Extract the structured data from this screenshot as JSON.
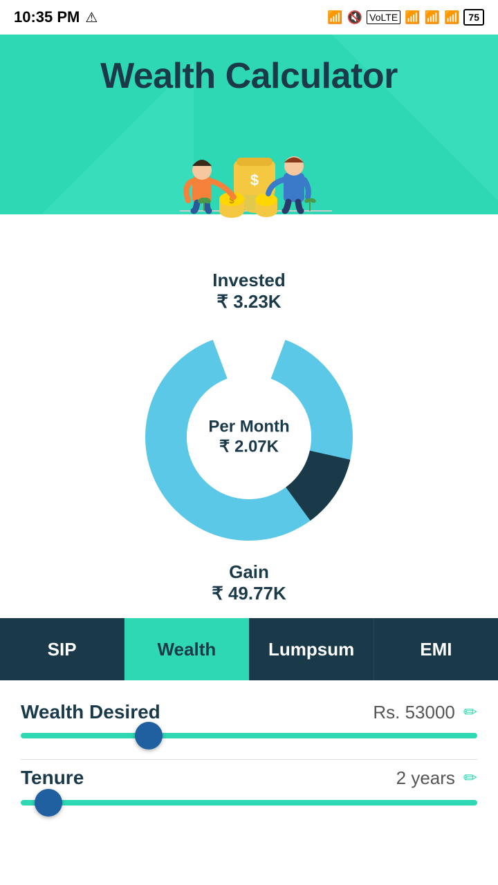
{
  "statusBar": {
    "time": "10:35 PM",
    "alert": "⚠",
    "battery": "75"
  },
  "header": {
    "title": "Wealth Calculator"
  },
  "chart": {
    "invested_label": "Invested",
    "invested_value": "₹ 3.23K",
    "center_label": "Per Month",
    "center_value": "₹ 2.07K",
    "gain_label": "Gain",
    "gain_value": "₹ 49.77K",
    "light_color": "#5cc8e8",
    "dark_color": "#1a3a4a",
    "light_percent": 88,
    "dark_percent": 12
  },
  "tabs": [
    {
      "label": "SIP",
      "active": false
    },
    {
      "label": "Wealth",
      "active": true
    },
    {
      "label": "Lumpsum",
      "active": false
    },
    {
      "label": "EMI",
      "active": false
    }
  ],
  "controls": {
    "wealth_desired_label": "Wealth Desired",
    "wealth_desired_value": "Rs. 53000",
    "edit_icon": "✏",
    "tenure_label": "Tenure",
    "tenure_value": "2",
    "tenure_unit": "years"
  }
}
